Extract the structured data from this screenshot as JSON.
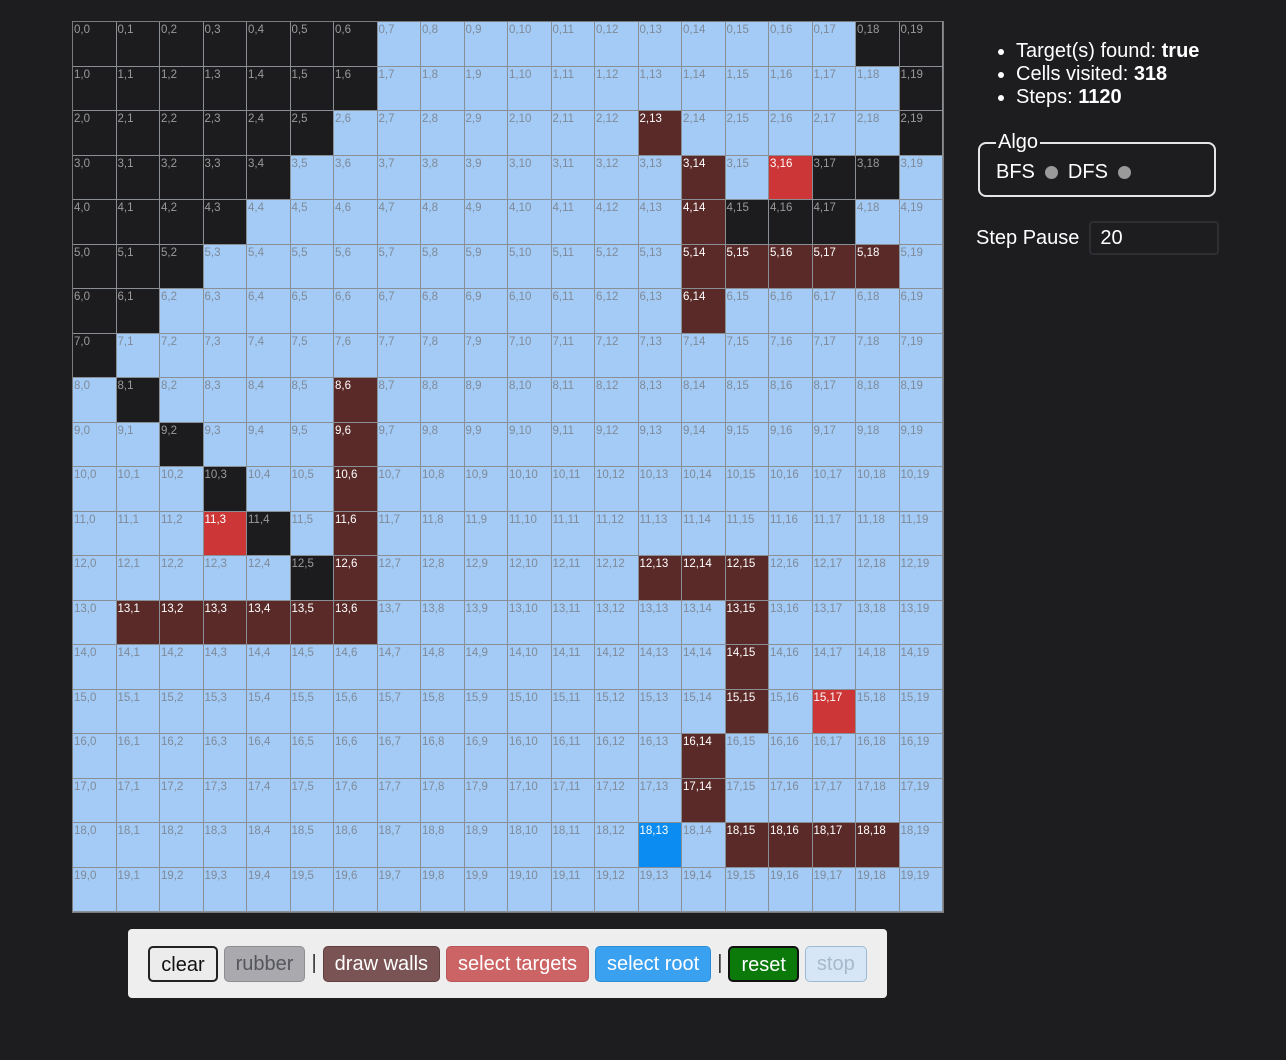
{
  "grid": {
    "rows": 20,
    "cols": 20,
    "walls": [
      [
        0,
        0
      ],
      [
        0,
        1
      ],
      [
        0,
        2
      ],
      [
        0,
        3
      ],
      [
        0,
        4
      ],
      [
        0,
        5
      ],
      [
        0,
        6
      ],
      [
        0,
        18
      ],
      [
        0,
        19
      ],
      [
        1,
        0
      ],
      [
        1,
        1
      ],
      [
        1,
        2
      ],
      [
        1,
        3
      ],
      [
        1,
        4
      ],
      [
        1,
        5
      ],
      [
        1,
        6
      ],
      [
        1,
        19
      ],
      [
        2,
        0
      ],
      [
        2,
        1
      ],
      [
        2,
        2
      ],
      [
        2,
        3
      ],
      [
        2,
        4
      ],
      [
        2,
        5
      ],
      [
        2,
        19
      ],
      [
        3,
        0
      ],
      [
        3,
        1
      ],
      [
        3,
        2
      ],
      [
        3,
        3
      ],
      [
        3,
        4
      ],
      [
        3,
        17
      ],
      [
        3,
        18
      ],
      [
        4,
        0
      ],
      [
        4,
        1
      ],
      [
        4,
        2
      ],
      [
        4,
        3
      ],
      [
        4,
        15
      ],
      [
        4,
        16
      ],
      [
        4,
        17
      ],
      [
        5,
        0
      ],
      [
        5,
        1
      ],
      [
        5,
        2
      ],
      [
        6,
        0
      ],
      [
        6,
        1
      ],
      [
        7,
        0
      ],
      [
        8,
        1
      ],
      [
        9,
        2
      ],
      [
        10,
        3
      ],
      [
        11,
        4
      ],
      [
        12,
        5
      ]
    ],
    "path": [
      [
        2,
        13
      ],
      [
        3,
        14
      ],
      [
        4,
        14
      ],
      [
        5,
        14
      ],
      [
        5,
        15
      ],
      [
        5,
        16
      ],
      [
        5,
        17
      ],
      [
        5,
        18
      ],
      [
        6,
        14
      ],
      [
        8,
        6
      ],
      [
        9,
        6
      ],
      [
        10,
        6
      ],
      [
        11,
        6
      ],
      [
        12,
        6
      ],
      [
        12,
        13
      ],
      [
        12,
        14
      ],
      [
        12,
        15
      ],
      [
        13,
        1
      ],
      [
        13,
        2
      ],
      [
        13,
        3
      ],
      [
        13,
        4
      ],
      [
        13,
        5
      ],
      [
        13,
        6
      ],
      [
        13,
        15
      ],
      [
        14,
        15
      ],
      [
        15,
        15
      ],
      [
        16,
        14
      ],
      [
        17,
        14
      ],
      [
        18,
        15
      ],
      [
        18,
        16
      ],
      [
        18,
        17
      ],
      [
        18,
        18
      ]
    ],
    "targets": [
      [
        3,
        16
      ],
      [
        11,
        3
      ],
      [
        15,
        17
      ]
    ],
    "root": [
      18,
      13
    ]
  },
  "stats": {
    "targets_label": "Target(s) found: ",
    "targets_value": "true",
    "visited_label": "Cells visited: ",
    "visited_value": "318",
    "steps_label": "Steps: ",
    "steps_value": "1120"
  },
  "algo": {
    "legend": "Algo",
    "options": [
      "BFS",
      "DFS"
    ]
  },
  "pause": {
    "label": "Step Pause",
    "value": "20"
  },
  "toolbar": {
    "clear": "clear",
    "rubber": "rubber",
    "separator": "|",
    "draw_walls": "draw walls",
    "select_targets": "select targets",
    "select_root": "select root",
    "reset": "reset",
    "stop": "stop"
  },
  "colors": {
    "background": "#1d1d20",
    "cell_empty": "#a3cbf5",
    "cell_wall": "#1c1c1f",
    "cell_path": "#5a2a29",
    "cell_target": "#cc3636",
    "cell_root": "#0a8cf2"
  }
}
